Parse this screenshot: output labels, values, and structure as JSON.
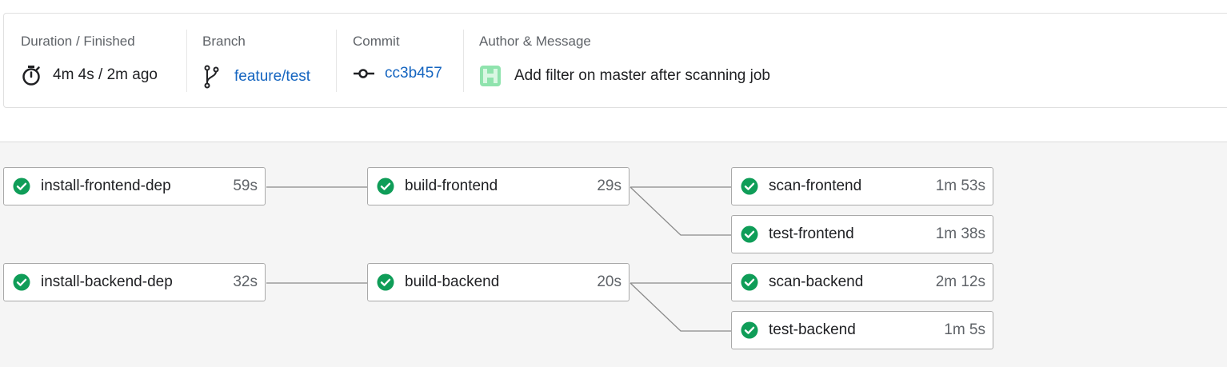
{
  "summary": {
    "duration": {
      "label": "Duration / Finished",
      "value": "4m 4s / 2m ago",
      "icon": "stopwatch-icon"
    },
    "branch": {
      "label": "Branch",
      "value": "feature/test",
      "icon": "branch-icon"
    },
    "commit": {
      "label": "Commit",
      "value": "cc3b457",
      "icon": "commit-icon"
    },
    "author": {
      "label": "Author & Message",
      "message": "Add filter on master after scanning job",
      "icon": "author-avatar"
    }
  },
  "jobs": [
    {
      "name": "install-frontend-dep",
      "duration": "59s",
      "status": "success"
    },
    {
      "name": "build-frontend",
      "duration": "29s",
      "status": "success"
    },
    {
      "name": "scan-frontend",
      "duration": "1m 53s",
      "status": "success"
    },
    {
      "name": "test-frontend",
      "duration": "1m 38s",
      "status": "success"
    },
    {
      "name": "install-backend-dep",
      "duration": "32s",
      "status": "success"
    },
    {
      "name": "build-backend",
      "duration": "20s",
      "status": "success"
    },
    {
      "name": "scan-backend",
      "duration": "2m 12s",
      "status": "success"
    },
    {
      "name": "test-backend",
      "duration": "1m 5s",
      "status": "success"
    }
  ],
  "colors": {
    "success": "#0f9d58",
    "link": "#1565c0",
    "avatar": "#7ee0a0"
  }
}
